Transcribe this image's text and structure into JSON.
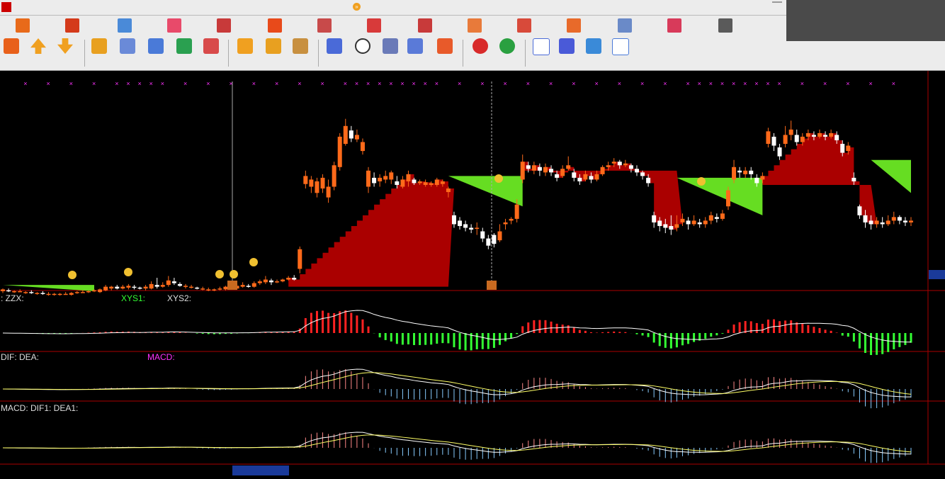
{
  "menubar": {
    "items": [],
    "right_items": []
  },
  "banner": {},
  "toolbar": {
    "buttons": []
  },
  "chart_title": "",
  "panels": {
    "main": {
      "price_high": "",
      "price_low": "",
      "price_mid": "",
      "right_price": "",
      "annotation": "",
      "labels": {
        "l1": "",
        "l2": "",
        "l3": ""
      },
      "tag_shangshan": "",
      "tag_xiashan": ""
    },
    "macd_variant": {
      "title": "",
      "v1": "",
      "zzx": "",
      "xys1": "",
      "xys2": "",
      "label_climb": "",
      "label_future": ""
    },
    "macd": {
      "title": "",
      "dif": "",
      "dea": "",
      "macd": ""
    },
    "macd_early": {
      "title": "",
      "macd": "",
      "dif1": "",
      "dea1": "",
      "note1": "",
      "note2a": "",
      "note2b": ""
    }
  },
  "xaxis": {
    "labels": [],
    "cursor_date": ""
  },
  "colors": {
    "bg": "#000000",
    "red_area": "#aa0000",
    "green_area": "#66dd22",
    "up_candle": "#ff6a1a",
    "down_candle": "#ffffff",
    "magenta": "#ff33ff",
    "macd_red": "#ff2222",
    "macd_green": "#33ff33"
  },
  "chart_data": {
    "type": "candlestick",
    "ylim": [
      3.64,
      5.6
    ],
    "candles": [
      [
        3.45,
        3.47,
        3.48,
        3.43
      ],
      [
        3.46,
        3.45,
        3.48,
        3.44
      ],
      [
        3.44,
        3.45,
        3.46,
        3.43
      ],
      [
        3.45,
        3.45,
        3.47,
        3.44
      ],
      [
        3.43,
        3.44,
        3.45,
        3.42
      ],
      [
        3.44,
        3.43,
        3.46,
        3.42
      ],
      [
        3.42,
        3.43,
        3.44,
        3.41
      ],
      [
        3.43,
        3.42,
        3.45,
        3.41
      ],
      [
        3.42,
        3.42,
        3.44,
        3.4
      ],
      [
        3.42,
        3.42,
        3.43,
        3.4
      ],
      [
        3.41,
        3.42,
        3.43,
        3.4
      ],
      [
        3.42,
        3.42,
        3.44,
        3.41
      ],
      [
        3.41,
        3.43,
        3.44,
        3.4
      ],
      [
        3.43,
        3.44,
        3.45,
        3.42
      ],
      [
        3.44,
        3.44,
        3.46,
        3.43
      ],
      [
        3.44,
        3.45,
        3.46,
        3.43
      ],
      [
        3.45,
        3.46,
        3.47,
        3.44
      ],
      [
        3.44,
        3.47,
        3.48,
        3.43
      ],
      [
        3.46,
        3.5,
        3.52,
        3.45
      ],
      [
        3.48,
        3.5,
        3.51,
        3.46
      ],
      [
        3.5,
        3.48,
        3.52,
        3.47
      ],
      [
        3.48,
        3.5,
        3.52,
        3.47
      ],
      [
        3.49,
        3.51,
        3.53,
        3.47
      ],
      [
        3.5,
        3.49,
        3.52,
        3.47
      ],
      [
        3.49,
        3.48,
        3.5,
        3.47
      ],
      [
        3.48,
        3.5,
        3.52,
        3.46
      ],
      [
        3.48,
        3.53,
        3.56,
        3.47
      ],
      [
        3.52,
        3.5,
        3.6,
        3.48
      ],
      [
        3.5,
        3.52,
        3.55,
        3.49
      ],
      [
        3.52,
        3.57,
        3.62,
        3.5
      ],
      [
        3.56,
        3.54,
        3.6,
        3.52
      ],
      [
        3.53,
        3.51,
        3.55,
        3.5
      ],
      [
        3.5,
        3.51,
        3.53,
        3.48
      ],
      [
        3.5,
        3.5,
        3.52,
        3.48
      ],
      [
        3.49,
        3.48,
        3.5,
        3.47
      ],
      [
        3.48,
        3.48,
        3.5,
        3.46
      ],
      [
        3.47,
        3.47,
        3.49,
        3.45
      ],
      [
        3.46,
        3.47,
        3.48,
        3.45
      ],
      [
        3.47,
        3.48,
        3.5,
        3.46
      ],
      [
        3.47,
        3.5,
        3.51,
        3.46
      ],
      [
        3.49,
        3.49,
        3.51,
        3.47
      ],
      [
        3.48,
        3.51,
        3.53,
        3.47
      ],
      [
        3.5,
        3.52,
        3.55,
        3.49
      ],
      [
        3.51,
        3.5,
        3.53,
        3.49
      ],
      [
        3.5,
        3.54,
        3.56,
        3.49
      ],
      [
        3.54,
        3.56,
        3.58,
        3.52
      ],
      [
        3.55,
        3.58,
        3.62,
        3.53
      ],
      [
        3.57,
        3.55,
        3.59,
        3.52
      ],
      [
        3.55,
        3.56,
        3.58,
        3.54
      ],
      [
        3.56,
        3.58,
        3.59,
        3.55
      ],
      [
        3.58,
        3.6,
        3.62,
        3.57
      ],
      [
        3.6,
        3.58,
        3.63,
        3.57
      ],
      [
        3.7,
        3.92,
        3.95,
        3.65
      ],
      [
        4.65,
        4.74,
        4.8,
        4.6
      ],
      [
        4.62,
        4.7,
        4.74,
        4.55
      ],
      [
        4.55,
        4.68,
        4.72,
        4.5
      ],
      [
        4.6,
        4.72,
        4.76,
        4.55
      ],
      [
        4.5,
        4.62,
        4.7,
        4.44
      ],
      [
        4.62,
        4.86,
        4.9,
        4.58
      ],
      [
        4.84,
        5.18,
        5.22,
        4.8
      ],
      [
        5.1,
        5.3,
        5.38,
        5.08
      ],
      [
        5.25,
        5.16,
        5.3,
        5.12
      ],
      [
        5.15,
        5.2,
        5.26,
        5.12
      ],
      [
        5.02,
        5.12,
        5.16,
        4.98
      ],
      [
        4.62,
        4.8,
        4.84,
        4.55
      ],
      [
        4.72,
        4.66,
        4.78,
        4.62
      ],
      [
        4.68,
        4.72,
        4.76,
        4.62
      ],
      [
        4.7,
        4.74,
        4.8,
        4.66
      ],
      [
        4.7,
        4.78,
        4.8,
        4.65
      ],
      [
        4.68,
        4.64,
        4.74,
        4.6
      ],
      [
        4.62,
        4.7,
        4.74,
        4.6
      ],
      [
        4.68,
        4.76,
        4.8,
        4.62
      ],
      [
        4.7,
        4.66,
        4.72,
        4.64
      ],
      [
        4.66,
        4.68,
        4.7,
        4.64
      ],
      [
        4.64,
        4.67,
        4.7,
        4.62
      ],
      [
        4.64,
        4.66,
        4.68,
        4.62
      ],
      [
        4.64,
        4.7,
        4.72,
        4.62
      ],
      [
        4.65,
        4.68,
        4.7,
        4.62
      ],
      [
        4.56,
        4.6,
        4.62,
        4.5
      ],
      [
        4.3,
        4.2,
        4.34,
        4.16
      ],
      [
        4.24,
        4.18,
        4.28,
        4.14
      ],
      [
        4.2,
        4.16,
        4.24,
        4.12
      ],
      [
        4.16,
        4.14,
        4.2,
        4.1
      ],
      [
        4.15,
        4.16,
        4.22,
        4.08
      ],
      [
        4.12,
        4.04,
        4.16,
        4
      ],
      [
        4.04,
        3.96,
        4.08,
        3.92
      ],
      [
        4.08,
        3.98,
        4.1,
        3.94
      ],
      [
        4.02,
        4.12,
        4.2,
        4
      ],
      [
        4.2,
        4.22,
        4.26,
        4.14
      ],
      [
        4.24,
        4.26,
        4.28,
        4.2
      ],
      [
        4.26,
        4.42,
        4.48,
        4.22
      ],
      [
        4.7,
        4.9,
        4.98,
        4.66
      ],
      [
        4.86,
        4.82,
        4.9,
        4.78
      ],
      [
        4.8,
        4.86,
        4.9,
        4.76
      ],
      [
        4.84,
        4.8,
        4.88,
        4.74
      ],
      [
        4.78,
        4.84,
        4.88,
        4.74
      ],
      [
        4.82,
        4.78,
        4.86,
        4.74
      ],
      [
        4.76,
        4.72,
        4.8,
        4.68
      ],
      [
        4.74,
        4.82,
        4.86,
        4.72
      ],
      [
        4.82,
        4.86,
        4.96,
        4.8
      ],
      [
        4.78,
        4.72,
        4.82,
        4.68
      ],
      [
        4.72,
        4.68,
        4.76,
        4.64
      ],
      [
        4.7,
        4.76,
        4.8,
        4.68
      ],
      [
        4.74,
        4.7,
        4.78,
        4.66
      ],
      [
        4.7,
        4.76,
        4.8,
        4.68
      ],
      [
        4.76,
        4.84,
        4.86,
        4.74
      ],
      [
        4.84,
        4.86,
        4.9,
        4.8
      ],
      [
        4.88,
        4.9,
        4.94,
        4.84
      ],
      [
        4.9,
        4.86,
        4.92,
        4.82
      ],
      [
        4.86,
        4.88,
        4.92,
        4.84
      ],
      [
        4.86,
        4.82,
        4.88,
        4.78
      ],
      [
        4.82,
        4.78,
        4.86,
        4.74
      ],
      [
        4.78,
        4.74,
        4.8,
        4.7
      ],
      [
        4.72,
        4.66,
        4.76,
        4.62
      ],
      [
        4.3,
        4.22,
        4.34,
        4.16
      ],
      [
        4.24,
        4.18,
        4.28,
        4.12
      ],
      [
        4.2,
        4.16,
        4.26,
        4.1
      ],
      [
        4.18,
        4.14,
        4.3,
        4.08
      ],
      [
        4.16,
        4.2,
        4.3,
        4.12
      ],
      [
        4.22,
        4.26,
        4.32,
        4.18
      ],
      [
        4.24,
        4.2,
        4.28,
        4.14
      ],
      [
        4.2,
        4.24,
        4.3,
        4.18
      ],
      [
        4.22,
        4.2,
        4.26,
        4.16
      ],
      [
        4.2,
        4.24,
        4.28,
        4.16
      ],
      [
        4.24,
        4.3,
        4.34,
        4.2
      ],
      [
        4.28,
        4.26,
        4.32,
        4.22
      ],
      [
        4.26,
        4.32,
        4.36,
        4.24
      ],
      [
        4.4,
        4.58,
        4.62,
        4.36
      ],
      [
        4.7,
        4.84,
        4.92,
        4.66
      ],
      [
        4.8,
        4.78,
        4.84,
        4.72
      ],
      [
        4.76,
        4.8,
        4.84,
        4.72
      ],
      [
        4.8,
        4.76,
        4.84,
        4.7
      ],
      [
        4.72,
        4.66,
        4.76,
        4.62
      ],
      [
        4.7,
        4.74,
        4.78,
        4.66
      ],
      [
        5.1,
        5.24,
        5.28,
        5.06
      ],
      [
        5.18,
        5.08,
        5.22,
        5.02
      ],
      [
        5.06,
        4.96,
        5.1,
        4.92
      ],
      [
        5.1,
        5.2,
        5.3,
        5.06
      ],
      [
        5.2,
        5.26,
        5.36,
        5.14
      ],
      [
        5.2,
        5.12,
        5.26,
        5.08
      ],
      [
        5.12,
        5.18,
        5.22,
        5.08
      ],
      [
        5.18,
        5.22,
        5.26,
        5.14
      ],
      [
        5.2,
        5.18,
        5.24,
        5.14
      ],
      [
        5.18,
        5.22,
        5.26,
        5.16
      ],
      [
        5.2,
        5.18,
        5.24,
        5.14
      ],
      [
        5.18,
        5.22,
        5.26,
        5.16
      ],
      [
        5.2,
        5.14,
        5.24,
        5.1
      ],
      [
        5.1,
        5.0,
        5.14,
        4.96
      ],
      [
        5.02,
        5.08,
        5.12,
        4.98
      ],
      [
        4.72,
        4.68,
        4.78,
        4.64
      ],
      [
        4.4,
        4.3,
        4.42,
        4.26
      ],
      [
        4.3,
        4.22,
        4.36,
        4.16
      ],
      [
        4.24,
        4.2,
        4.3,
        4.14
      ],
      [
        4.2,
        4.24,
        4.28,
        4.16
      ],
      [
        4.22,
        4.2,
        4.28,
        4.16
      ],
      [
        4.2,
        4.24,
        4.3,
        4.18
      ],
      [
        4.24,
        4.28,
        4.34,
        4.2
      ],
      [
        4.28,
        4.24,
        4.3,
        4.2
      ],
      [
        4.24,
        4.22,
        4.28,
        4.18
      ],
      [
        4.22,
        4.24,
        4.28,
        4.18
      ]
    ]
  }
}
